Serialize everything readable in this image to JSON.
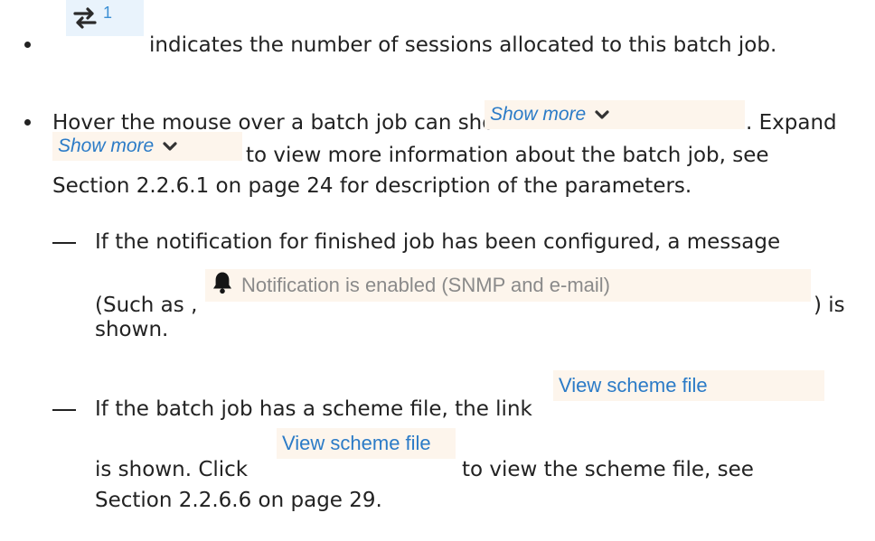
{
  "doc": {
    "b1": {
      "count": "1",
      "text": "indicates the number of sessions allocated to this batch job."
    },
    "b2": {
      "line1_pre": "Hover the mouse over a batch job can show",
      "show_more": "Show more",
      "line1_post": ". Expand",
      "line2_post": "to view more information about the batch job, see",
      "line3": "Section 2.2.6.1 on page 24 for description of the parameters."
    },
    "d1": {
      "line1": "If the notification for finished job has been configured, a message",
      "pre": "(Such as ,",
      "notification": "Notification is enabled (SNMP and e-mail)",
      "post": ") is",
      "line3": "shown."
    },
    "d2": {
      "line1_pre": "If the batch job has a scheme file, the link",
      "link": "View scheme file",
      "l2_a": "is shown.  Click",
      "l2_b": "to view the scheme file, see",
      "line3": "Section 2.2.6.6 on page 29."
    }
  }
}
